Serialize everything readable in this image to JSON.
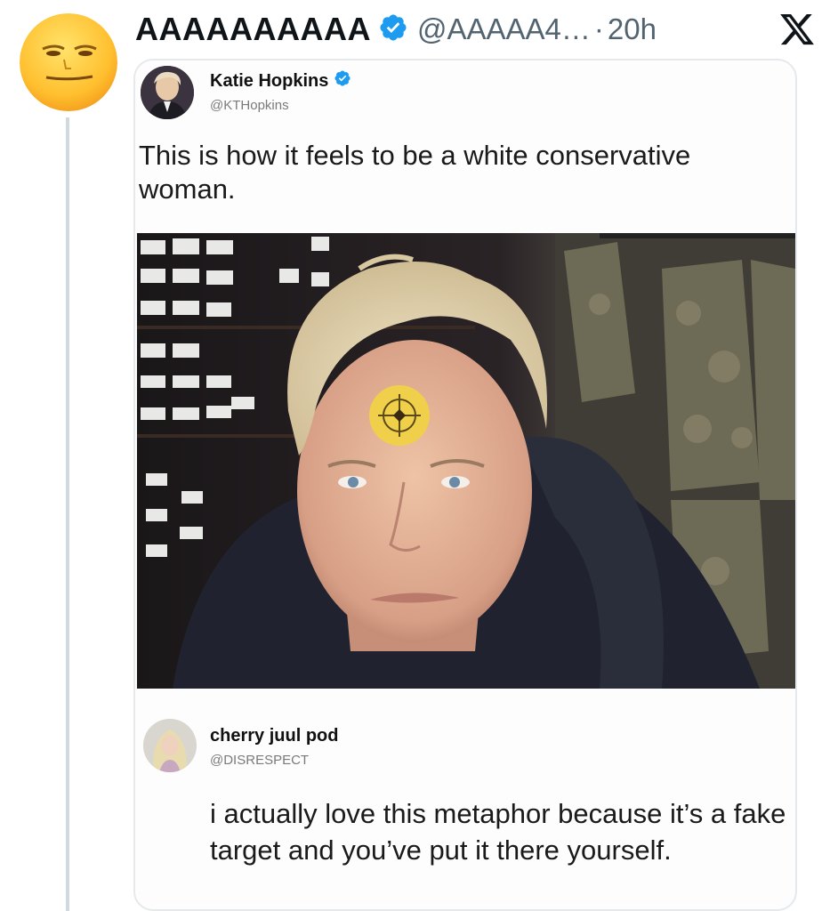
{
  "post": {
    "display_name": "AAAAAAAAAA",
    "handle": "@AAAAA4…",
    "separator": "·",
    "time": "20h",
    "avatar_icon": "yellow-face-emoji-avatar",
    "platform_icon": "x-logo-icon",
    "verified_color": "#1d9bf0"
  },
  "quoted_tweet": {
    "display_name": "Katie Hopkins",
    "handle": "@KTHopkins",
    "text": "This is how it feels to be a white conservative woman.",
    "photo_icon": "photo-woman-with-target-sticker",
    "verified_color": "#1d9bf0"
  },
  "reply": {
    "display_name": "cherry juul pod",
    "handle": "@DISRESPECT",
    "text": "i actually love this metaphor because it’s a fake target and you’ve put it there yourself."
  }
}
